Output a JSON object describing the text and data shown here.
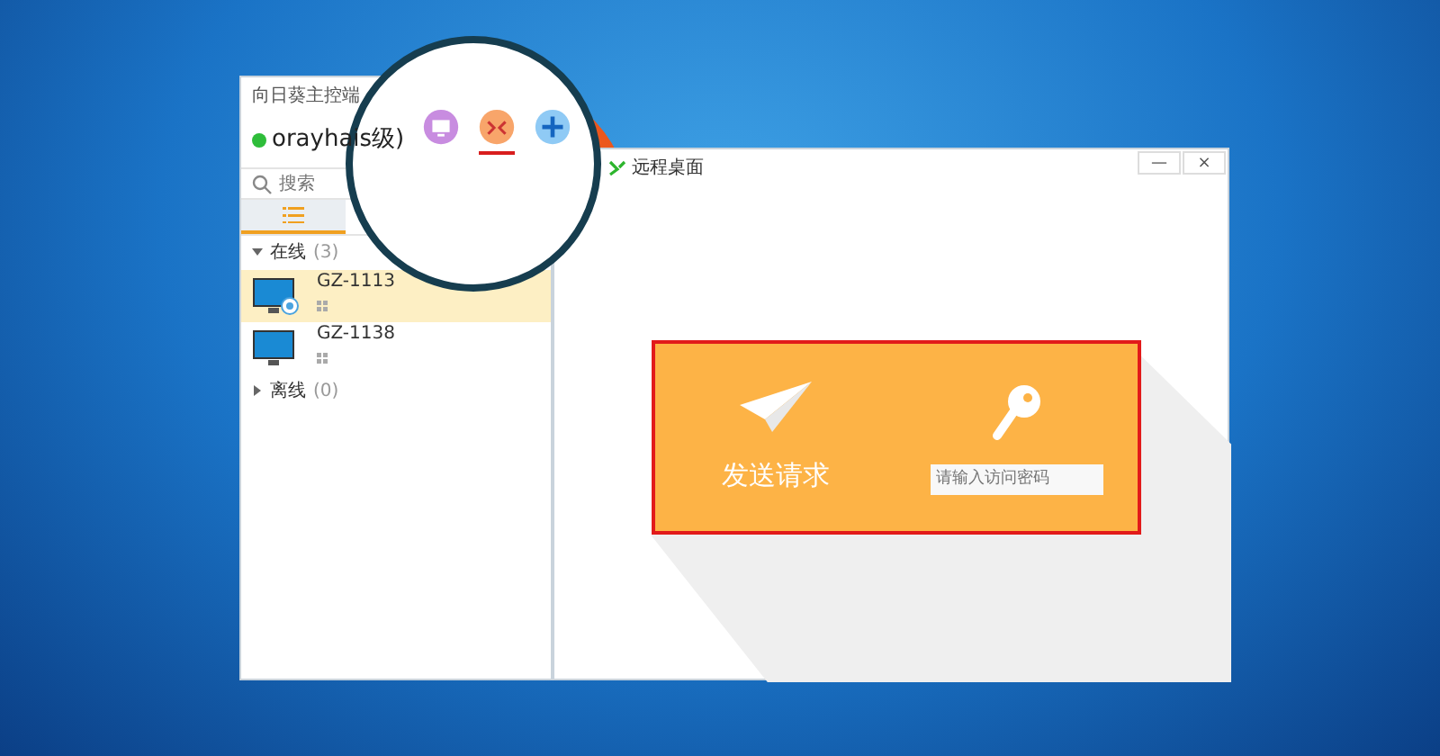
{
  "main_window": {
    "title": "向日葵主控端",
    "user": {
      "name": "orayhais级)",
      "online": true
    },
    "toolbar": [
      {
        "kind": "monitor",
        "selected": false
      },
      {
        "kind": "remote",
        "selected": true
      },
      {
        "kind": "add",
        "selected": false
      }
    ],
    "search": {
      "placeholder": "搜索"
    },
    "list_tab": {
      "selected": true
    },
    "groups": [
      {
        "label": "在线",
        "count": "(3)",
        "expanded": true,
        "devices": [
          {
            "name": "GZ-1113",
            "selected": true,
            "connected": true
          },
          {
            "name": "GZ-1138",
            "selected": false,
            "connected": false
          }
        ]
      },
      {
        "label": "离线",
        "count": "(0)",
        "expanded": false
      }
    ]
  },
  "remote_window": {
    "title": "远程桌面",
    "controls": [
      "—",
      "×"
    ],
    "send_request": {
      "label": "发送请求"
    },
    "password": {
      "placeholder": "请输入访问密码"
    }
  }
}
